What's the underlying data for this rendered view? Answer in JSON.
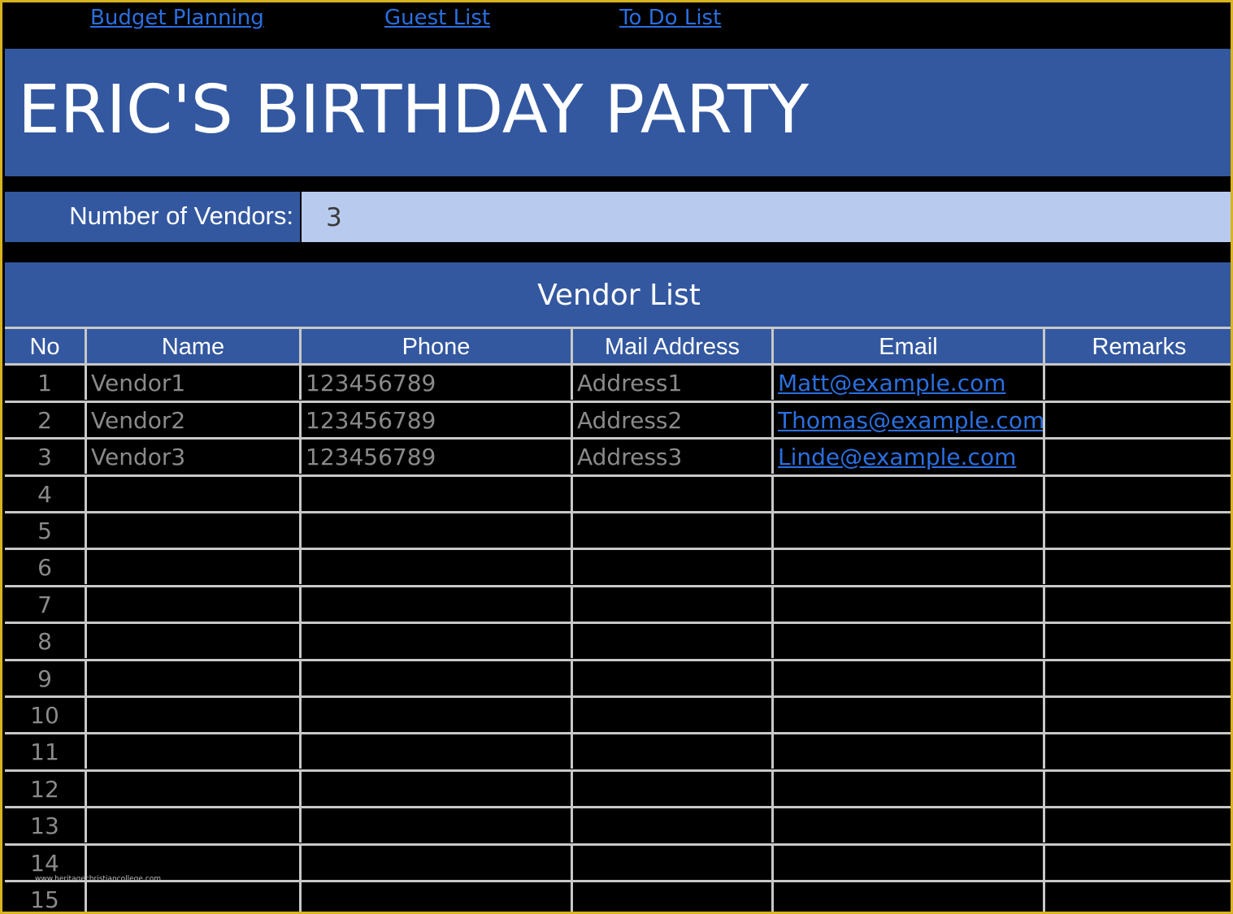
{
  "nav": {
    "links": [
      "Budget Planning",
      "Guest List",
      "To Do List"
    ]
  },
  "title": "ERIC'S BIRTHDAY PARTY",
  "vendors_count": {
    "label": "Number of Vendors:",
    "value": "3"
  },
  "list_title": "Vendor List",
  "table": {
    "columns": [
      "No",
      "Name",
      "Phone",
      "Mail Address",
      "Email",
      "Remarks"
    ],
    "rows": [
      {
        "no": "1",
        "name": "Vendor1",
        "phone": "123456789",
        "address": "Address1",
        "email": "Matt@example.com",
        "remarks": ""
      },
      {
        "no": "2",
        "name": "Vendor2",
        "phone": "123456789",
        "address": "Address2",
        "email": "Thomas@example.com",
        "remarks": ""
      },
      {
        "no": "3",
        "name": "Vendor3",
        "phone": "123456789",
        "address": "Address3",
        "email": "Linde@example.com",
        "remarks": ""
      },
      {
        "no": "4",
        "name": "",
        "phone": "",
        "address": "",
        "email": "",
        "remarks": ""
      },
      {
        "no": "5",
        "name": "",
        "phone": "",
        "address": "",
        "email": "",
        "remarks": ""
      },
      {
        "no": "6",
        "name": "",
        "phone": "",
        "address": "",
        "email": "",
        "remarks": ""
      },
      {
        "no": "7",
        "name": "",
        "phone": "",
        "address": "",
        "email": "",
        "remarks": ""
      },
      {
        "no": "8",
        "name": "",
        "phone": "",
        "address": "",
        "email": "",
        "remarks": ""
      },
      {
        "no": "9",
        "name": "",
        "phone": "",
        "address": "",
        "email": "",
        "remarks": ""
      },
      {
        "no": "10",
        "name": "",
        "phone": "",
        "address": "",
        "email": "",
        "remarks": ""
      },
      {
        "no": "11",
        "name": "",
        "phone": "",
        "address": "",
        "email": "",
        "remarks": ""
      },
      {
        "no": "12",
        "name": "",
        "phone": "",
        "address": "",
        "email": "",
        "remarks": ""
      },
      {
        "no": "13",
        "name": "",
        "phone": "",
        "address": "",
        "email": "",
        "remarks": ""
      },
      {
        "no": "14",
        "name": "",
        "phone": "",
        "address": "",
        "email": "",
        "remarks": ""
      },
      {
        "no": "15",
        "name": "",
        "phone": "",
        "address": "",
        "email": "",
        "remarks": ""
      }
    ]
  },
  "watermark": "www.heritagechristiancollege.com",
  "colors": {
    "band": "#3358a0",
    "value_fill": "#b8cbee",
    "link": "#2a6fe0",
    "frame": "#d9b420"
  }
}
